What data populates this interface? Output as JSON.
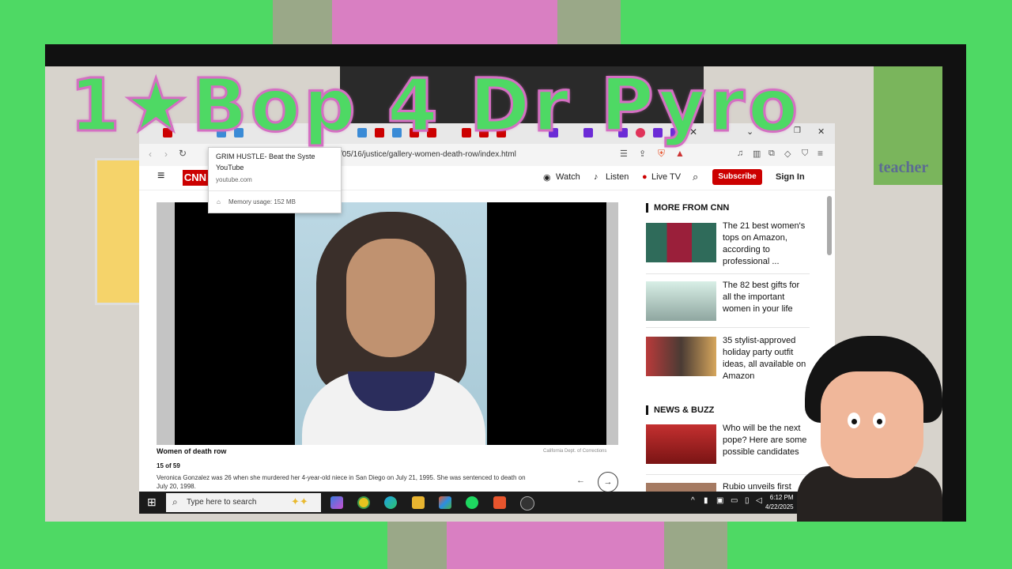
{
  "overlay_title": "1★Bop 4 Dr Pyro",
  "room_sign": "teacher",
  "browser": {
    "url": "/05/16/justice/gallery-women-death-row/index.html",
    "tooltip": {
      "title": "GRIM HUSTLE- Beat the Syste",
      "subtitle": "YouTube",
      "domain": "youtube.com",
      "memory": "Memory usage: 152 MB"
    }
  },
  "cnn": {
    "logo": "CNN",
    "nav": {
      "watch": "Watch",
      "listen": "Listen",
      "live": "Live TV",
      "subscribe": "Subscribe",
      "signin": "Sign In"
    },
    "gallery": {
      "title": "Women of death row",
      "credit": "California Dept. of Corrections",
      "count": "15 of 59",
      "description": "Veronica Gonzalez was 26 when she murdered her 4-year-old niece in San Diego on July 21, 1995. She was sentenced to death on July 20, 1998."
    },
    "more_header": "MORE FROM CNN",
    "more": [
      {
        "title": "The 21 best women's tops on Amazon, according to professional ..."
      },
      {
        "title": "The 82 best gifts for all the important women in your life"
      },
      {
        "title": "35 stylist-approved holiday party outfit ideas, all available on Amazon"
      }
    ],
    "news_header": "NEWS & BUZZ",
    "news": [
      {
        "title": "Who will be the next pope? Here are some possible candidates"
      },
      {
        "title": "Rubio unveils first"
      }
    ]
  },
  "taskbar": {
    "search_placeholder": "Type here to search",
    "time": "6:12 PM",
    "date": "4/22/2025"
  }
}
